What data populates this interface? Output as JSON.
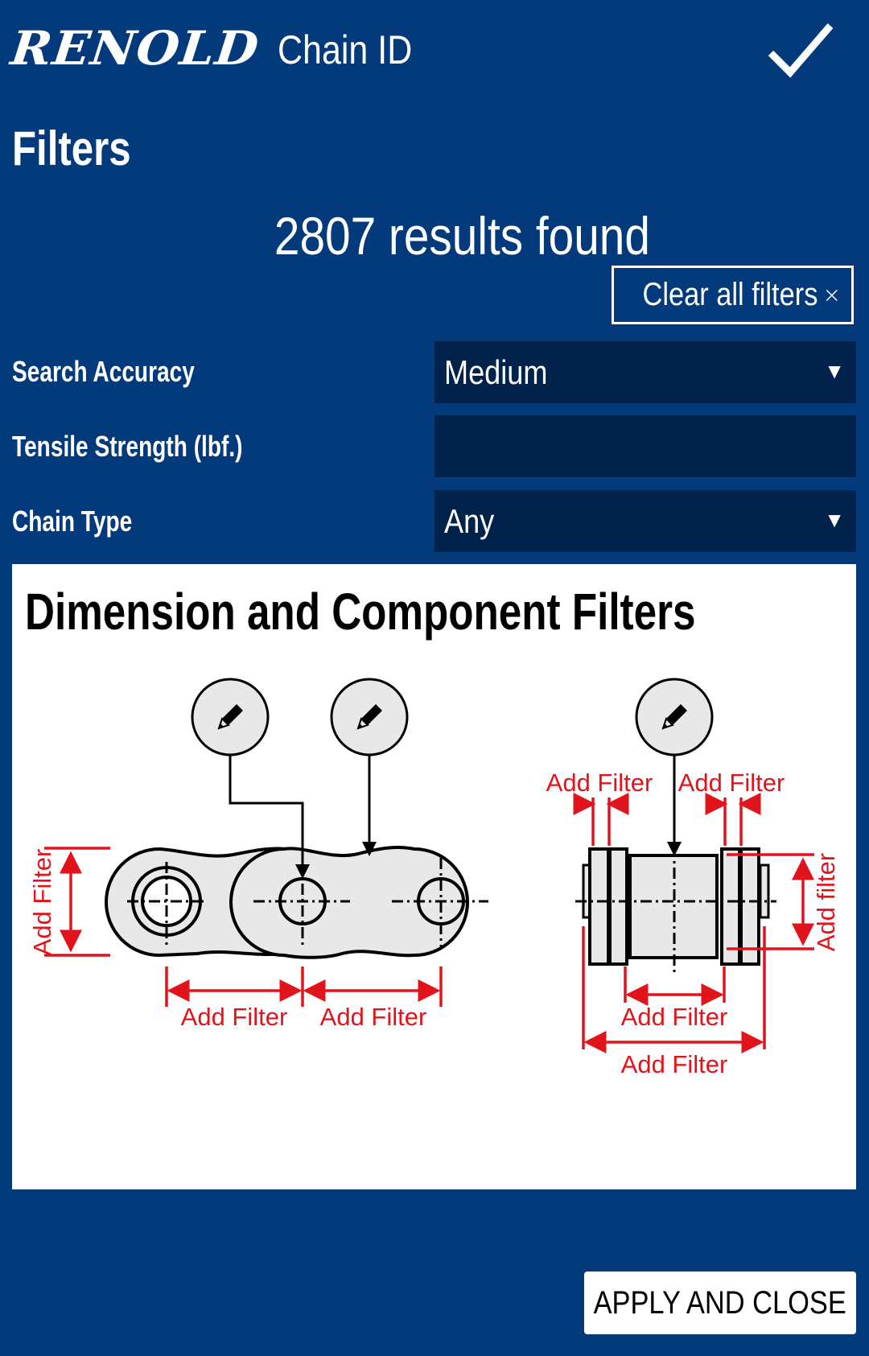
{
  "header": {
    "logo_text": "RENOLD",
    "app_title": "Chain ID",
    "confirm_icon": "checkmark-icon"
  },
  "page": {
    "heading": "Filters",
    "results_text": "2807 results found",
    "clear_button": {
      "label": "Clear all filters",
      "icon": "close-icon"
    }
  },
  "filters": [
    {
      "label": "Search Accuracy",
      "type": "select",
      "value": "Medium"
    },
    {
      "label": "Tensile Strength (lbf.)",
      "type": "input",
      "value": ""
    },
    {
      "label": "Chain Type",
      "type": "select",
      "value": "Any"
    }
  ],
  "dimension_panel": {
    "title": "Dimension and Component Filters",
    "edit_icon": "pencil-icon",
    "side_view": {
      "height_label": "Add Filter",
      "pitch_label_1": "Add Filter",
      "pitch_label_2": "Add Filter"
    },
    "end_view": {
      "left_plate_label": "Add Filter",
      "right_plate_label": "Add Filter",
      "height_label": "Add filter",
      "inner_width_label": "Add Filter",
      "overall_width_label": "Add Filter"
    }
  },
  "footer": {
    "apply_button": "APPLY AND CLOSE"
  },
  "colors": {
    "background": "#033a7c",
    "field_background": "#01224a",
    "dimension_red": "#e1141c",
    "panel": "#ffffff"
  }
}
